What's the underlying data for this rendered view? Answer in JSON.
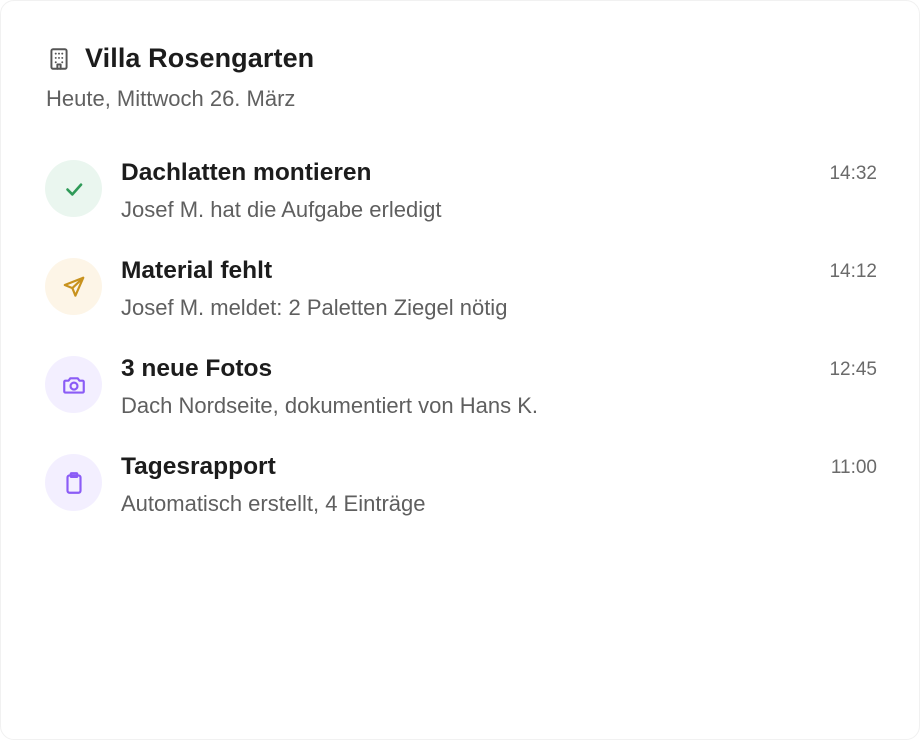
{
  "header": {
    "title": "Villa Rosengarten",
    "subtitle": "Heute, Mittwoch 26. März",
    "icon": "building-icon"
  },
  "feed": [
    {
      "title": "Dachlatten montieren",
      "subtitle": "Josef M. hat die Aufgabe erledigt",
      "time": "14:32",
      "icon": "check-icon",
      "icon_color": "#2f9a58",
      "bg_color": "#eaf6ef"
    },
    {
      "title": "Material fehlt",
      "subtitle": "Josef M. meldet: 2 Paletten Ziegel nötig",
      "time": "14:12",
      "icon": "send-icon",
      "icon_color": "#c8921e",
      "bg_color": "#fdf5e7"
    },
    {
      "title": "3 neue Fotos",
      "subtitle": "Dach Nordseite, dokumentiert von Hans K.",
      "time": "12:45",
      "icon": "camera-icon",
      "icon_color": "#8b5cf6",
      "bg_color": "#f3efff"
    },
    {
      "title": "Tagesrapport",
      "subtitle": "Automatisch erstellt, 4 Einträge",
      "time": "11:00",
      "icon": "clipboard-icon",
      "icon_color": "#8b5cf6",
      "bg_color": "#f3efff"
    }
  ]
}
